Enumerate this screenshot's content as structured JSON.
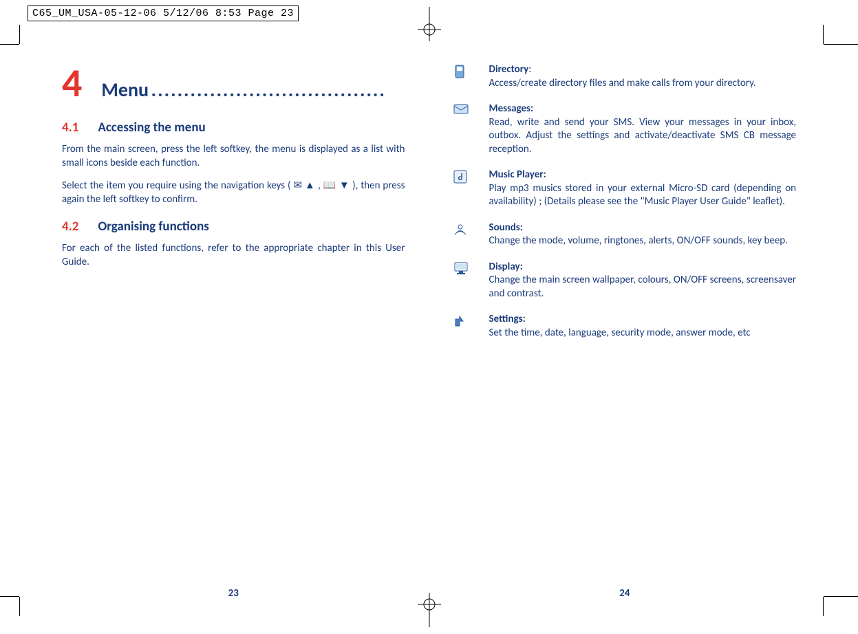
{
  "print_header": "C65_UM_USA-05-12-06  5/12/06  8:53  Page 23",
  "left": {
    "page_number": "23",
    "chapter_number": "4",
    "chapter_title": "Menu",
    "sections": [
      {
        "number": "4.1",
        "title": "Accessing the menu",
        "paragraphs": [
          "From the main screen, press the left softkey, the menu is displayed as a list with small icons beside each function.",
          "Select the item you require using the navigation keys ( ✉ ▲ , 📖 ▼ ), then press again the left softkey to confirm."
        ]
      },
      {
        "number": "4.2",
        "title": "Organising functions",
        "paragraphs": [
          "For each of the listed functions, refer to the appropriate chapter in this User Guide."
        ]
      }
    ]
  },
  "right": {
    "page_number": "24",
    "functions": [
      {
        "icon": "directory-icon",
        "title": "Directory",
        "suffix": ":",
        "desc": "Access/create directory files and make calls from your directory."
      },
      {
        "icon": "messages-icon",
        "title": "Messages:",
        "suffix": "",
        "desc": "Read, write and send your SMS. View your messages in your inbox, outbox. Adjust the settings and activate/deactivate SMS CB message reception."
      },
      {
        "icon": "music-player-icon",
        "title": "Music Player:",
        "suffix": "",
        "desc": "Play mp3 musics stored in your external Micro-SD card (depending on availability) ; (Details please see the \"Music Player User Guide\" leaflet)."
      },
      {
        "icon": "sounds-icon",
        "title": "Sounds:",
        "suffix": "",
        "desc": "Change the mode, volume, ringtones, alerts, ON/OFF sounds, key beep."
      },
      {
        "icon": "display-icon",
        "title": "Display:",
        "suffix": "",
        "desc": "Change the main screen wallpaper, colours, ON/OFF screens, screensaver and contrast."
      },
      {
        "icon": "settings-icon",
        "title": "Settings:",
        "suffix": "",
        "desc": "Set the time, date, language, security mode, answer mode, etc"
      }
    ]
  }
}
